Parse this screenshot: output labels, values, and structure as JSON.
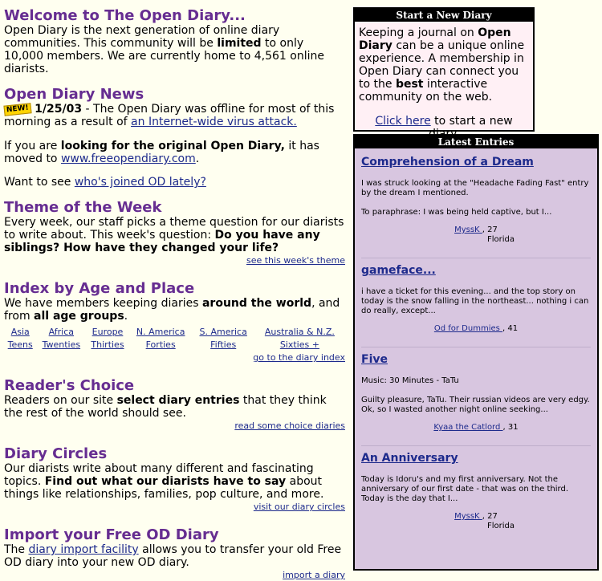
{
  "welcome": {
    "title": "Welcome to The Open Diary...",
    "text_pre": "Open Diary is the next generation of online diary communities. This community will be ",
    "bold": "limited",
    "text_post": " to only 10,000 members. We are currently home to 4,561 online diarists."
  },
  "news": {
    "title": "Open Diary News",
    "badge": "NEW!",
    "date": "1/25/03",
    "text_pre": " - The Open Diary was offline for most of this morning as a result of ",
    "link": "an Internet-wide virus attack.",
    "p2_pre": "If you are ",
    "p2_bold": "looking for the original Open Diary,",
    "p2_mid": " it has moved to ",
    "p2_link": "www.freeopendiary.com",
    "p2_end": ".",
    "p3_pre": "Want to see ",
    "p3_link": "who's joined OD lately?"
  },
  "theme": {
    "title": "Theme of the Week",
    "text_pre": "Every week, our staff picks a theme question for our diarists to write about. This week's question: ",
    "bold": "Do you have any siblings? How have they changed your life?",
    "link": "see this week's theme"
  },
  "index": {
    "title": "Index by Age and Place",
    "text_pre": "We have members keeping diaries ",
    "bold1": "around the world",
    "text_mid": ", and from ",
    "bold2": "all age groups",
    "text_end": ".",
    "places": [
      "Asia",
      "Africa",
      "Europe",
      "N. America",
      "S. America",
      "Australia & N.Z."
    ],
    "ages": [
      "Teens",
      "Twenties",
      "Thirties",
      "Forties",
      "Fifties",
      "Sixties +"
    ],
    "link": "go to the diary index"
  },
  "choice": {
    "title": "Reader's Choice",
    "text_pre": "Readers on our site ",
    "bold": "select diary entries",
    "text_post": " that they think the rest of the world should see.",
    "link": "read some choice diaries"
  },
  "circles": {
    "title": "Diary Circles",
    "text1": "Our diarists write about many different and fascinating topics. ",
    "bold": "Find out what our diarists have to say",
    "text2": " about things like relationships, families, pop culture, and more.",
    "link": "visit our diary circles"
  },
  "import": {
    "title": "Import your Free OD Diary",
    "text_pre": "The ",
    "link": "diary import facility",
    "text_post": " allows you to transfer your old Free OD diary into your new OD diary.",
    "link2": "import a diary"
  },
  "start": {
    "header": "Start a New Diary",
    "t1": "Keeping a journal on ",
    "b1": "Open Diary",
    "t2": " can be a unique online experience. A membership in Open Diary can connect you to the ",
    "b2": "best",
    "t3": " interactive community on the web.",
    "link": "Click here",
    "link_post": " to start a new diary."
  },
  "latest": {
    "header": "Latest Entries",
    "entries": [
      {
        "title": "Comprehension of a Dream",
        "paras": [
          "I was struck looking at the \"Headache Fading Fast\" entry by the dream I mentioned.",
          "To paraphrase: I was being held captive, but I..."
        ],
        "author": "MyssK ",
        "age": ", 27",
        "location": "Florida"
      },
      {
        "title": "gameface...",
        "paras": [
          "i have a ticket for this evening... and the top story on today is the snow falling in the northeast... nothing i can do really, except..."
        ],
        "author": "Od for Dummies ",
        "age": ", 41",
        "location": ""
      },
      {
        "title": "Five",
        "paras": [
          "Music: 30 Minutes - TaTu",
          "Guilty pleasure, TaTu. Their russian videos are very edgy. Ok, so I wasted another night online seeking..."
        ],
        "author": "Kyaa the Catlord ",
        "age": ", 31",
        "location": ""
      },
      {
        "title": "An Anniversary",
        "paras": [
          "Today is Idoru's and my first anniversary. Not the anniversary of our first date - that was on the third. Today is the day that I..."
        ],
        "author": "MyssK ",
        "age": ", 27",
        "location": "Florida"
      }
    ]
  }
}
